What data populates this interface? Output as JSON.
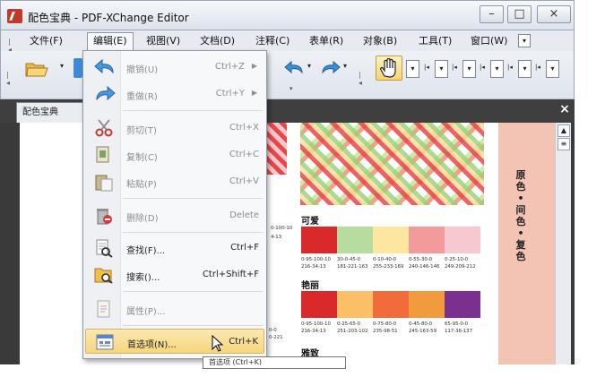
{
  "window": {
    "title": "配色宝典 - PDF-XChange Editor",
    "controls": {
      "minimize": "–",
      "maximize": "□",
      "close": "×"
    }
  },
  "menubar": {
    "items": [
      {
        "label": "文件(F)"
      },
      {
        "label": "编辑(E)",
        "active": true
      },
      {
        "label": "视图(V)"
      },
      {
        "label": "文档(D)"
      },
      {
        "label": "注释(C)"
      },
      {
        "label": "表单(R)"
      },
      {
        "label": "对象(B)"
      },
      {
        "label": "工具(T)"
      },
      {
        "label": "窗口(W)"
      }
    ]
  },
  "tabs": [
    {
      "label": "配色宝典"
    }
  ],
  "edit_menu": {
    "items": [
      {
        "label": "撤销(U)",
        "shortcut": "Ctrl+Z",
        "submenu": true,
        "enabled": false,
        "icon": "undo-icon"
      },
      {
        "label": "重做(R)",
        "shortcut": "Ctrl+Y",
        "submenu": true,
        "enabled": false,
        "icon": "redo-icon"
      },
      {
        "label": "剪切(T)",
        "shortcut": "Ctrl+X",
        "enabled": false,
        "icon": "scissors-icon"
      },
      {
        "label": "复制(C)",
        "shortcut": "Ctrl+C",
        "enabled": false,
        "icon": "copy-icon"
      },
      {
        "label": "粘贴(P)",
        "shortcut": "Ctrl+V",
        "enabled": false,
        "icon": "paste-icon"
      },
      {
        "label": "删除(D)",
        "shortcut": "Delete",
        "enabled": false,
        "icon": "trash-icon"
      },
      {
        "label": "查找(F)...",
        "shortcut": "Ctrl+F",
        "enabled": true,
        "icon": "find-icon"
      },
      {
        "label": "搜索()...",
        "shortcut": "Ctrl+Shift+F",
        "enabled": true,
        "icon": "search-folder-icon"
      },
      {
        "label": "属性(P)...",
        "shortcut": "",
        "enabled": false,
        "icon": "properties-icon"
      },
      {
        "label": "首选项(N)...",
        "shortcut": "Ctrl+K",
        "enabled": true,
        "highlighted": true,
        "icon": "preferences-icon"
      }
    ]
  },
  "tooltip": {
    "text": "首选项 (Ctrl+K)"
  },
  "document": {
    "sections": [
      {
        "title": "可爱",
        "colors": [
          "#d9292b",
          "#b6dc9f",
          "#fde7a0",
          "#f39a9b",
          "#f6c9d0"
        ],
        "codes": [
          "0-95-100-10\n216-34-13",
          "30-0-45-0\n181-221-163",
          "0-10-40-0\n255-233-169",
          "0-55-30-0\n240-146-146",
          "0-25-10-0\n249-209-212"
        ]
      },
      {
        "title": "艳丽",
        "colors": [
          "#d9292b",
          "#fbbf67",
          "#f26b3a",
          "#f19a3e",
          "#7b2f8e"
        ],
        "codes": [
          "0-95-100-10\n216-34-13",
          "0-25-65-0\n251-203-102",
          "0-75-80-0\n235-98-51",
          "0-45-80-0\n245-163-59",
          "65-95-0-0\n117-36-137"
        ]
      },
      {
        "title": "雅致",
        "colors": [],
        "codes": []
      }
    ],
    "partial_codes": [
      "0-100-10",
      "4-13",
      "0-0",
      "0-221"
    ],
    "side_label": "原色•间色•复色"
  }
}
